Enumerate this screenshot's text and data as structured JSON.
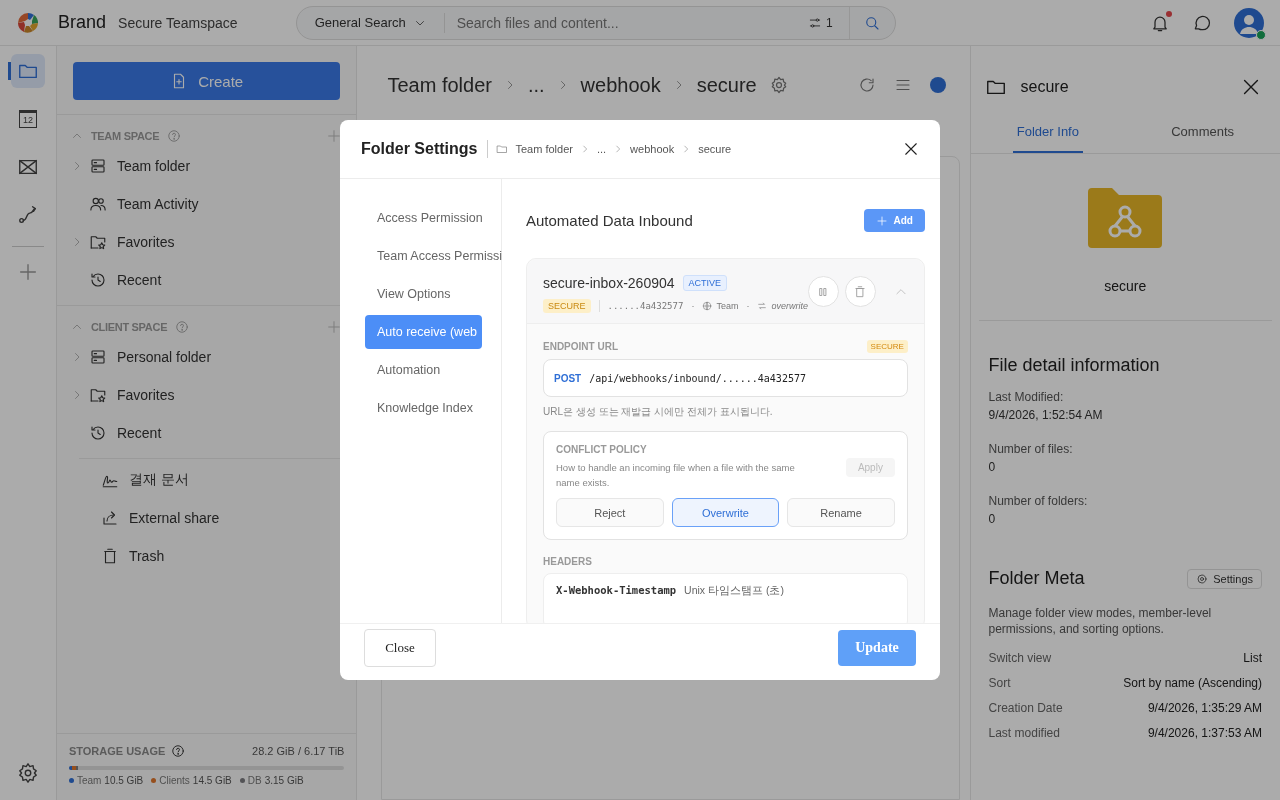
{
  "topbar": {
    "brand": "Brand",
    "workspace": "Secure Teamspace",
    "search_scope": "General Search",
    "search": {
      "placeholder": "Search files and content..."
    },
    "filter_count": "1",
    "notification_unread": true
  },
  "rail": [
    {
      "kind": "folder",
      "selected": true
    },
    {
      "kind": "calendar",
      "label": "12",
      "selected": false
    },
    {
      "kind": "mail",
      "selected": false
    },
    {
      "kind": "route",
      "selected": false
    }
  ],
  "sidebar": {
    "create": "Create",
    "sections": [
      {
        "title": "TEAM SPACE",
        "expanded": true,
        "items": [
          {
            "kind": "drive",
            "label": "Team folder",
            "expandable": true
          },
          {
            "kind": "people",
            "label": "Team Activity",
            "expandable": false
          },
          {
            "kind": "star-folder",
            "label": "Favorites",
            "expandable": true
          },
          {
            "kind": "history",
            "label": "Recent",
            "expandable": false
          }
        ]
      },
      {
        "title": "CLIENT SPACE",
        "expanded": true,
        "items": [
          {
            "kind": "drive",
            "label": "Personal folder",
            "expandable": true
          },
          {
            "kind": "star-folder",
            "label": "Favorites",
            "expandable": true
          },
          {
            "kind": "history",
            "label": "Recent",
            "expandable": false
          }
        ]
      }
    ],
    "extra": [
      {
        "kind": "signature",
        "label": "결재 문서"
      },
      {
        "kind": "share",
        "label": "External share"
      },
      {
        "kind": "trash",
        "label": "Trash"
      }
    ],
    "storage": {
      "title": "STORAGE USAGE",
      "total": "28.2 GiB / 6.17 TiB",
      "legend": [
        {
          "label": "Team",
          "value": "10.5 GiB",
          "color": "#1f4a8f",
          "level": 0.01
        },
        {
          "label": "Clients",
          "value": "14.5 GiB",
          "color": "#964f1d",
          "level": 0.015
        },
        {
          "label": "DB",
          "value": "3.15 GiB",
          "color": "#535356",
          "level": 0.007
        }
      ]
    }
  },
  "main": {
    "breadcrumb": [
      "Team folder",
      "...",
      "webhook",
      "secure"
    ]
  },
  "modal": {
    "title": "Folder Settings",
    "breadcrumb": [
      "Team folder",
      "...",
      "webhook",
      "secure"
    ],
    "nav": [
      {
        "label": "Access Permission",
        "selected": false
      },
      {
        "label": "Team Access Permissi",
        "selected": false
      },
      {
        "label": "View Options",
        "selected": false
      },
      {
        "label": "Auto receive (web",
        "selected": true
      },
      {
        "label": "Automation",
        "selected": false
      },
      {
        "label": "Knowledge Index",
        "selected": false
      }
    ],
    "section_title": "Automated Data Inbound",
    "add": "Add",
    "inbox": {
      "name": "secure-inbox-260904",
      "status": "ACTIVE",
      "tag": "SECURE",
      "token": "......4a432577",
      "separator": "·",
      "scope": "Team",
      "policy": "overwrite",
      "expanded": true,
      "endpoint": {
        "label": "ENDPOINT URL",
        "badge": "SECURE",
        "method": "POST",
        "path": "/api/webhooks/inbound/......4a432577",
        "note": "URL은 생성 또는 재발급 시에만 전체가 표시됩니다."
      },
      "conflict": {
        "title": "CONFLICT POLICY",
        "description": "How to handle an incoming file when a file with the same name exists.",
        "apply": "Apply",
        "apply_disabled": true,
        "options": [
          {
            "label": "Reject",
            "selected": false
          },
          {
            "label": "Overwrite",
            "selected": true
          },
          {
            "label": "Rename",
            "selected": false
          }
        ]
      },
      "headers": {
        "title": "HEADERS",
        "rows": [
          {
            "name": "X-Webhook-Timestamp",
            "description": "Unix 타임스탬프 (초)"
          }
        ]
      }
    },
    "close": "Close",
    "update": "Update"
  },
  "panel": {
    "title": "secure",
    "tabs": [
      {
        "label": "Folder Info",
        "selected": true
      },
      {
        "label": "Comments",
        "selected": false
      }
    ],
    "folder_name": "secure",
    "detail_title": "File detail information",
    "details": [
      {
        "label": "Last Modified:",
        "value": "9/4/2026, 1:52:54 AM"
      },
      {
        "label": "Number of files:",
        "value": "0"
      },
      {
        "label": "Number of folders:",
        "value": "0"
      }
    ],
    "meta_title": "Folder Meta",
    "settings": "Settings",
    "meta_description": "Manage folder view modes, member-level permissions, and sorting options.",
    "meta_rows": [
      {
        "label": "Switch view",
        "value": "List"
      },
      {
        "label": "Sort",
        "value": "Sort by name (Ascending)"
      },
      {
        "label": "Creation Date",
        "value": "9/4/2026, 1:35:29 AM"
      },
      {
        "label": "Last modified",
        "value": "9/4/2026, 1:37:53 AM"
      }
    ]
  }
}
